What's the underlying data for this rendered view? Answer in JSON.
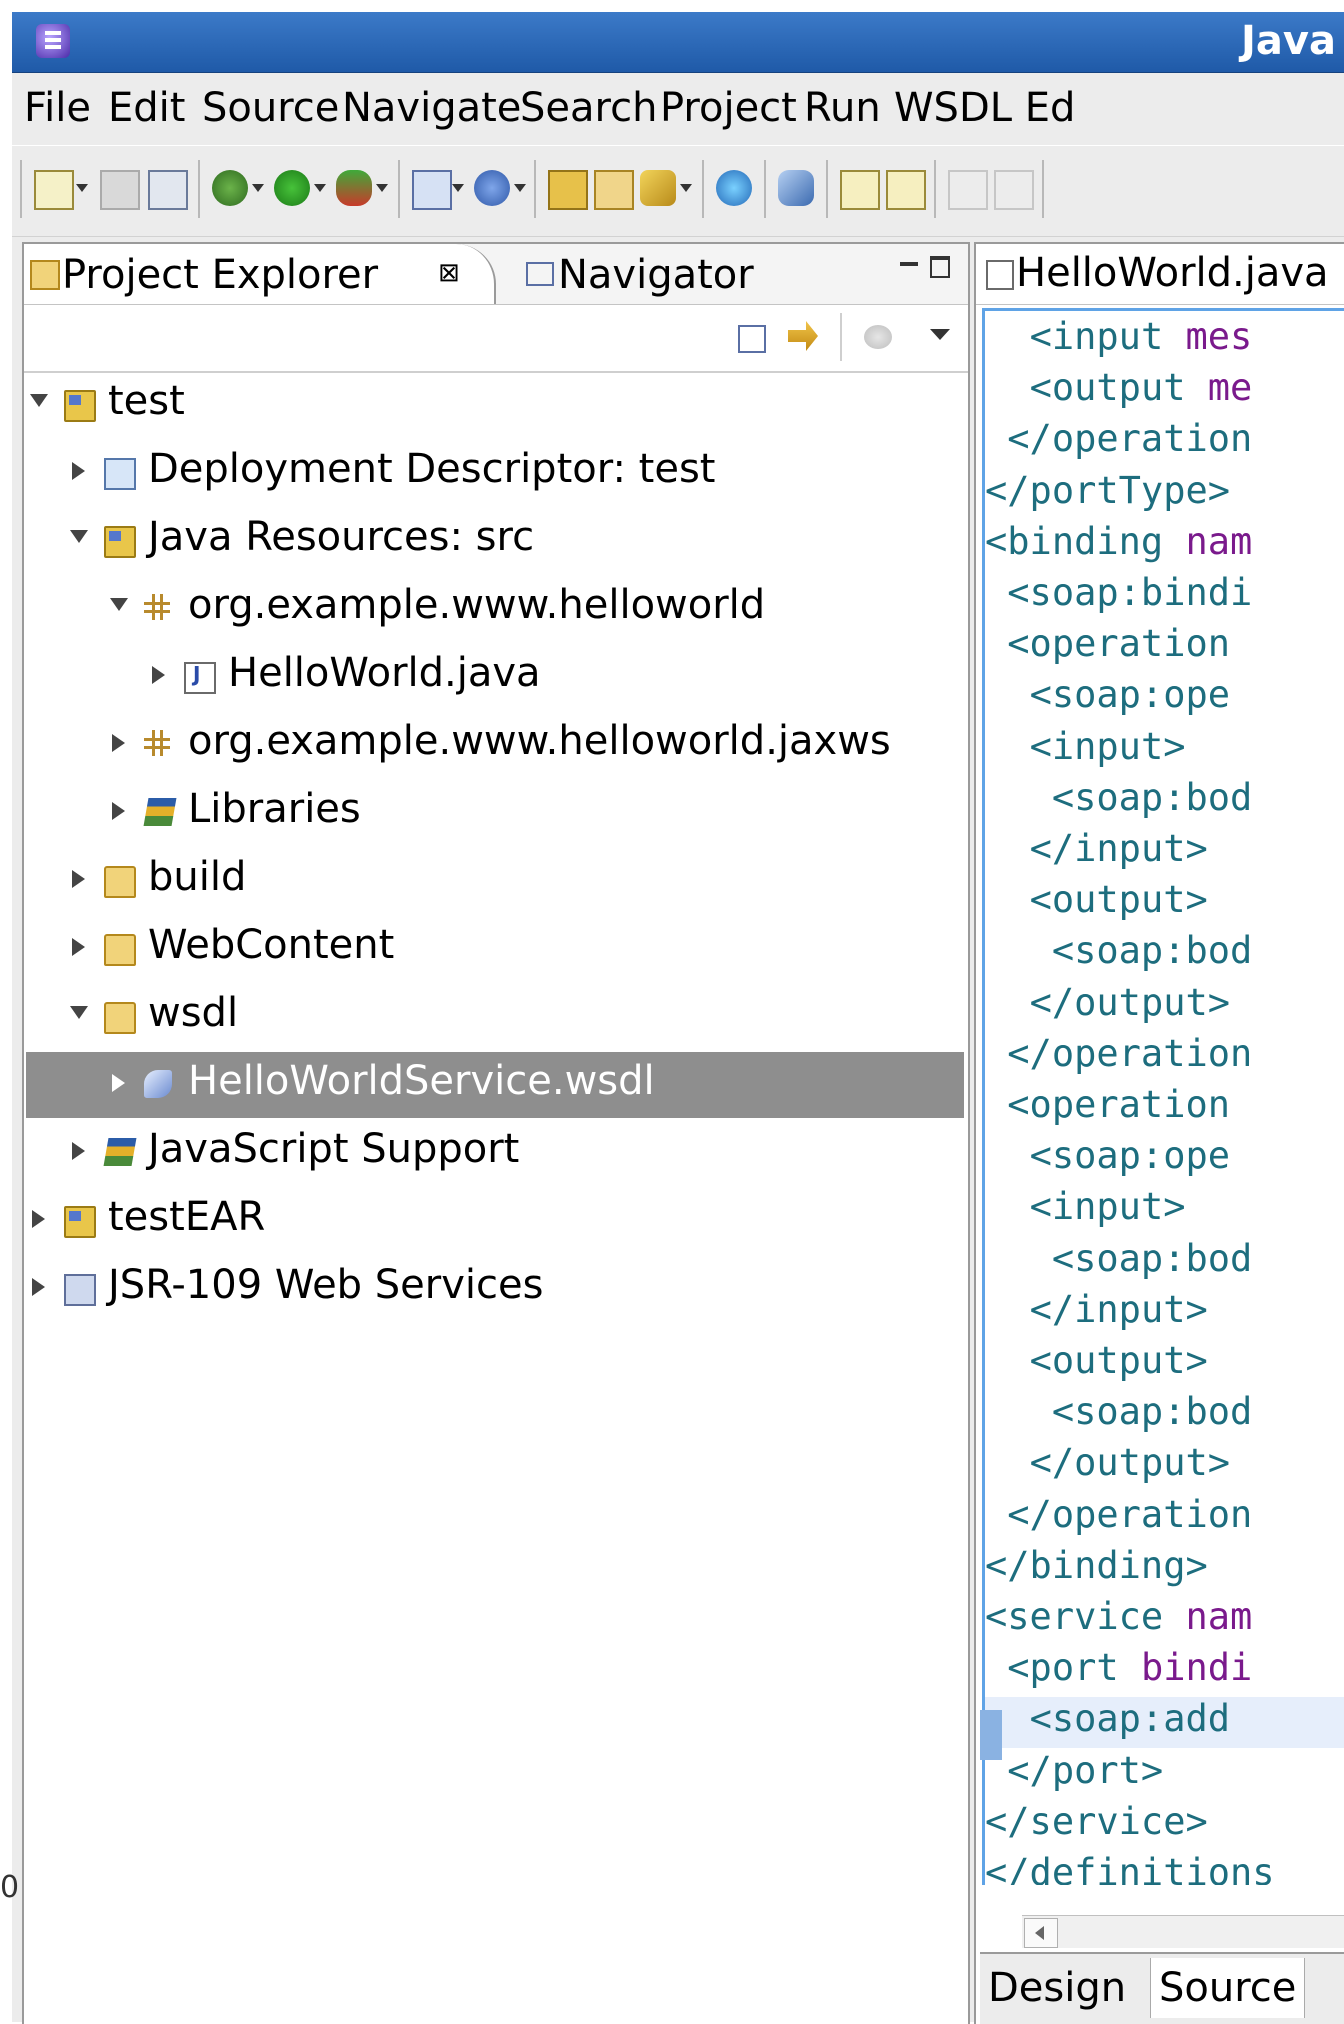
{
  "window": {
    "title": "Java"
  },
  "menubar": {
    "items": [
      "File",
      "Edit",
      "Source",
      "Navigate",
      "Search",
      "Project",
      "Run",
      "WSDL Ed"
    ]
  },
  "explorer": {
    "tabs": {
      "project_explorer": "Project Explorer",
      "navigator": "Navigator"
    },
    "tree": [
      {
        "label": "test",
        "level": 0,
        "expanded": true,
        "icon": "project-icon"
      },
      {
        "label": "Deployment Descriptor: test",
        "level": 1,
        "expanded": false,
        "icon": "deployment-descriptor-icon"
      },
      {
        "label": "Java Resources: src",
        "level": 1,
        "expanded": true,
        "icon": "java-resources-icon"
      },
      {
        "label": "org.example.www.helloworld",
        "level": 2,
        "expanded": true,
        "icon": "package-icon"
      },
      {
        "label": "HelloWorld.java",
        "level": 3,
        "expanded": false,
        "icon": "java-file-icon"
      },
      {
        "label": "org.example.www.helloworld.jaxws",
        "level": 2,
        "expanded": false,
        "icon": "package-icon"
      },
      {
        "label": "Libraries",
        "level": 2,
        "expanded": false,
        "icon": "library-icon"
      },
      {
        "label": "build",
        "level": 1,
        "expanded": false,
        "icon": "folder-icon"
      },
      {
        "label": "WebContent",
        "level": 1,
        "expanded": false,
        "icon": "folder-icon"
      },
      {
        "label": "wsdl",
        "level": 1,
        "expanded": true,
        "icon": "folder-icon"
      },
      {
        "label": "HelloWorldService.wsdl",
        "level": 2,
        "expanded": false,
        "icon": "wsdl-file-icon",
        "selected": true
      },
      {
        "label": "JavaScript Support",
        "level": 1,
        "expanded": false,
        "icon": "library-icon"
      },
      {
        "label": "testEAR",
        "level": 0,
        "expanded": false,
        "icon": "ear-project-icon"
      },
      {
        "label": "JSR-109 Web Services",
        "level": 0,
        "expanded": false,
        "icon": "web-services-icon"
      }
    ]
  },
  "editor": {
    "tab_title": "HelloWorld.java",
    "lines": [
      "  <input mes",
      "  <output me",
      " </operation",
      "</portType>",
      "<binding nam",
      " <soap:bindi",
      " <operation ",
      "  <soap:ope",
      "  <input>",
      "   <soap:bod",
      "  </input>",
      "  <output>",
      "   <soap:bod",
      "  </output>",
      " </operation",
      " <operation ",
      "  <soap:ope",
      "  <input>",
      "   <soap:bod",
      "  </input>",
      "  <output>",
      "   <soap:bod",
      "  </output>",
      " </operation",
      "</binding>",
      "<service nam",
      " <port bindi",
      "  <soap:add",
      " </port>",
      "</service>",
      "</definitions"
    ],
    "current_line_index": 27,
    "bottom_tabs": {
      "design": "Design",
      "source": "Source"
    }
  },
  "fragment": {
    "left_edge_text": "0"
  },
  "colors": {
    "titlebar": "#2a66b6",
    "selection": "#8e8e8e",
    "editor_border": "#5fa3e6",
    "tag": "#1d6d7e",
    "attr": "#7a1a8c"
  }
}
